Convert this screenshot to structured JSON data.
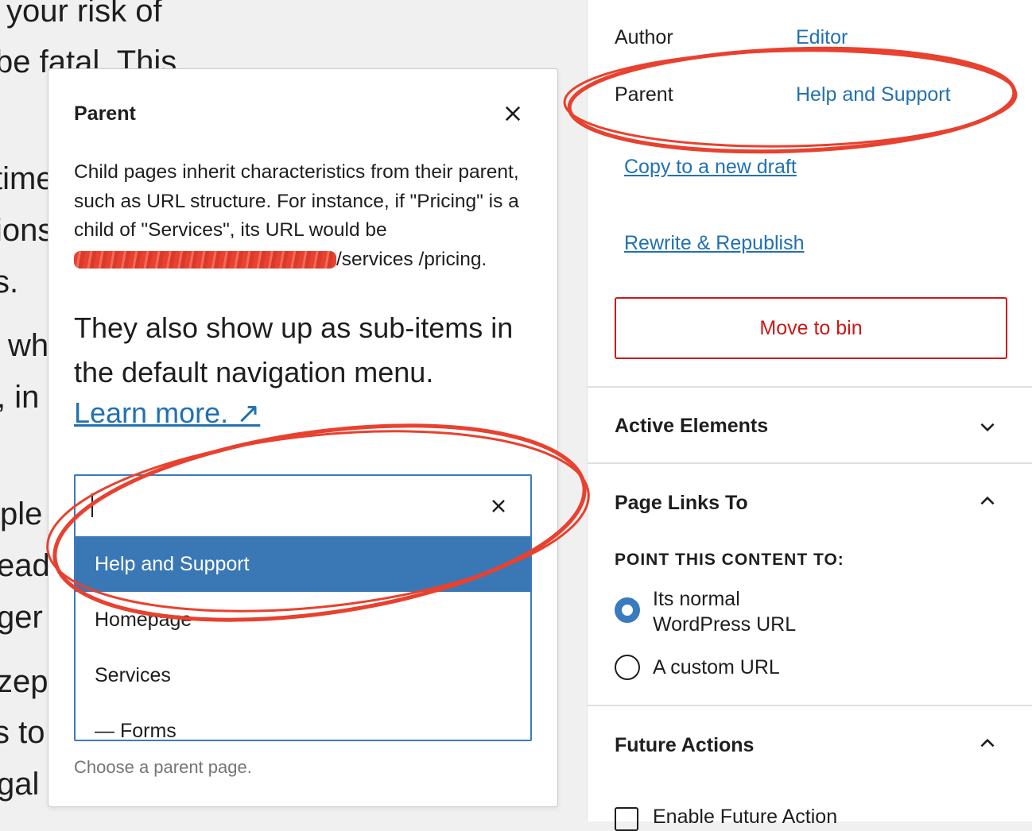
{
  "background_text": [
    "your risk of",
    "be fatal. This",
    "time",
    "ions",
    "s.",
    "wh",
    ", in",
    "ple",
    "ead",
    "ger",
    "zep",
    "s to",
    "gal"
  ],
  "sidebar": {
    "author_label": "Author",
    "author_value": "Editor",
    "parent_label": "Parent",
    "parent_value": "Help and Support",
    "copy_link": "Copy to a new draft",
    "rewrite_link": "Rewrite & Republish",
    "bin_button": "Move to bin",
    "panels": {
      "active_elements": "Active Elements",
      "page_links_to": "Page Links To",
      "future_actions": "Future Actions"
    },
    "point_label": "POINT THIS CONTENT TO:",
    "radio_normal_line1": "Its normal",
    "radio_normal_line2": "WordPress URL",
    "radio_custom": "A custom URL",
    "enable_future": "Enable Future Action"
  },
  "popover": {
    "title": "Parent",
    "desc_1": "Child pages inherit characteristics from their parent, such as URL structure. For instance, if \"Pricing\" is a child of \"Services\", its URL would be ",
    "desc_2": "/services /pricing.",
    "big_text": "They also show up as sub-items in the default navigation menu.",
    "learn_more": "Learn more. ↗",
    "search_value": "",
    "options": [
      "Help and Support",
      "Homepage",
      "Services",
      "— Forms"
    ],
    "selected": "Help and Support",
    "help_text": "Choose a parent page."
  },
  "colors": {
    "link": "#2271b1",
    "danger": "#cc1818",
    "selected_option": "#3a78b5",
    "annotation": "#e8412f"
  }
}
